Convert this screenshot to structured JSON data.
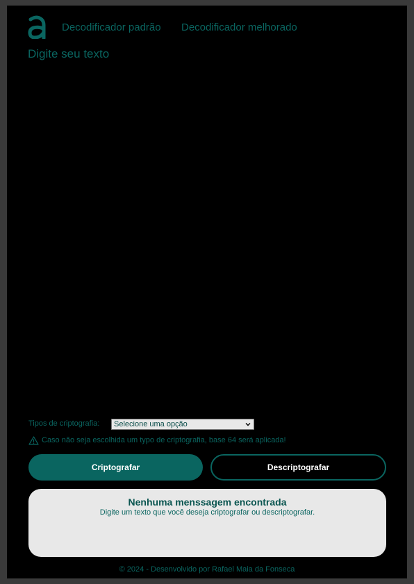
{
  "colors": {
    "accent": "#0a6560",
    "background": "#000000",
    "card": "#e8e8e8",
    "outer": "#3a3a3a"
  },
  "header": {
    "logo_icon": "alura-logo-icon",
    "nav": [
      {
        "label": "Decodificador padrão"
      },
      {
        "label": "Decodificador melhorado"
      }
    ]
  },
  "input": {
    "placeholder": "Digite seu texto",
    "value": ""
  },
  "crypto": {
    "label": "Tipos de criptografia:",
    "selected": "Selecione uma opção"
  },
  "warning": {
    "icon": "warning-triangle-icon",
    "text": "Caso não seja escolhida um typo de criptografia, base 64 será aplicada!"
  },
  "actions": {
    "encrypt_label": "Criptografar",
    "decrypt_label": "Descriptografar"
  },
  "output": {
    "title": "Nenhuma menssagem encontrada",
    "subtitle": "Digite um texto que você deseja criptografar ou descriptografar."
  },
  "footer": {
    "text": "© 2024 - Desenvolvido por Rafael Maia da Fonseca"
  }
}
